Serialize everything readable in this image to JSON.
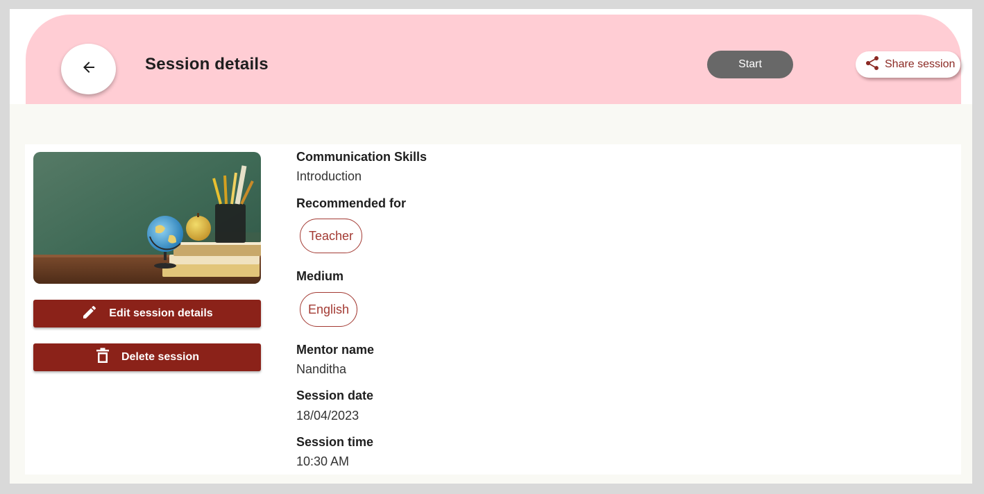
{
  "header": {
    "title": "Session details",
    "start_label": "Start",
    "share_label": "Share session"
  },
  "actions": {
    "edit_label": "Edit session details",
    "delete_label": "Delete session"
  },
  "session": {
    "title": "Communication Skills",
    "subtitle": "Introduction",
    "recommended_label": "Recommended for",
    "recommended_chip": "Teacher",
    "medium_label": "Medium",
    "medium_chip": "English",
    "mentor_label": "Mentor name",
    "mentor_value": "Nanditha",
    "date_label": "Session date",
    "date_value": "18/04/2023",
    "time_label": "Session time",
    "time_value": "10:30 AM"
  },
  "icons": {
    "back": "arrow-left-icon",
    "share": "share-icon",
    "edit": "pencil-icon",
    "delete": "trash-icon"
  },
  "colors": {
    "header_bg": "#ffcdd4",
    "primary": "#8b2219",
    "chip_accent": "#a33a33",
    "start_bg": "#686868"
  }
}
